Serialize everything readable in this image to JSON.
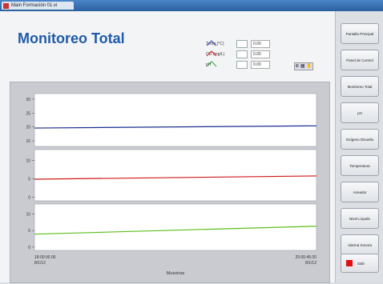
{
  "window": {
    "tab_title": "Main Formación 01.vi"
  },
  "page": {
    "title": "Monitoreo Total"
  },
  "legend": [
    {
      "label": "Temp (°C)",
      "value": "0.00",
      "color": "#3a4fc8"
    },
    {
      "label": "OD (mg/L)",
      "value": "0.00",
      "color": "#e02020"
    },
    {
      "label": "pH",
      "value": "0.00",
      "color": "#2aa836"
    }
  ],
  "legend_tools": "⊕ ▦ ✋",
  "chart_data": {
    "type": "line",
    "xlabel": "Muestras",
    "x_ticks": [
      "18:00:00.00\n8/1/12",
      "20:00:45.00\n8/1/12"
    ],
    "panels": [
      {
        "series": "Temp",
        "color": "#1c2d8f",
        "ticks": [
          "30",
          "25",
          "20",
          "15"
        ],
        "ylim": [
          13,
          32
        ],
        "values": [
          19.6,
          20.4
        ]
      },
      {
        "series": "OD",
        "color": "#d01818",
        "ticks": [
          "10",
          "5",
          "0"
        ],
        "ylim": [
          -1,
          13
        ],
        "values": [
          4.9,
          5.8
        ]
      },
      {
        "series": "pH",
        "color": "#5cbf1a",
        "ticks": [
          "10",
          "5",
          "0"
        ],
        "ylim": [
          -1,
          13
        ],
        "values": [
          3.9,
          6.3
        ]
      }
    ]
  },
  "sidebar": {
    "buttons": [
      "Pantalla Principal",
      "Panel de Control",
      "Monitoreo Total",
      "pH",
      "Oxígeno Disuelto",
      "Temperatura",
      "Aireador",
      "Nivel Líquido",
      "Alarma Sonora"
    ],
    "exit_label": "Salir"
  }
}
